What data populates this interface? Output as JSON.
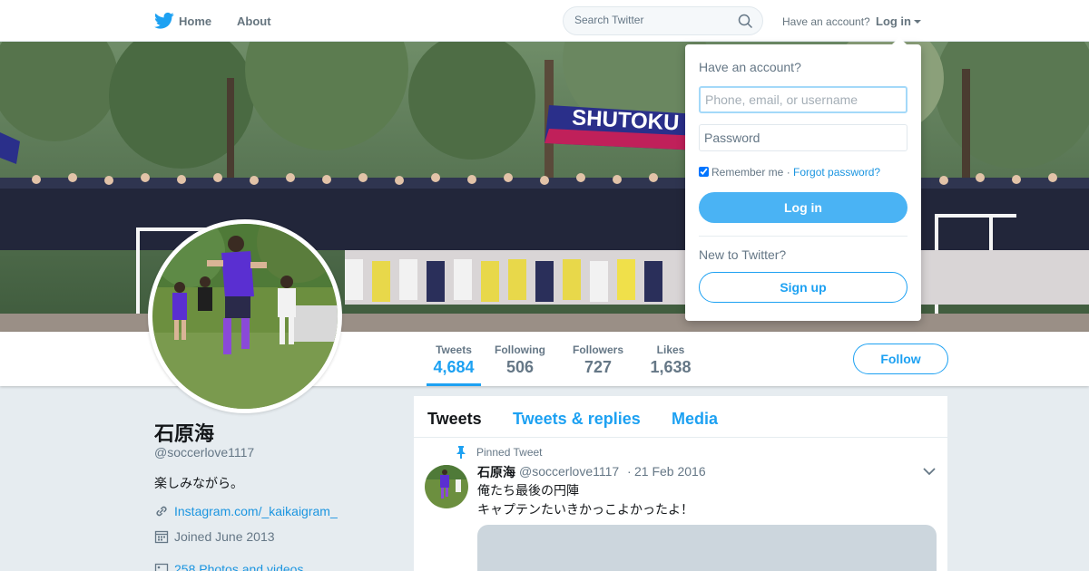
{
  "nav": {
    "home_label": "Home",
    "about_label": "About",
    "search_placeholder": "Search Twitter",
    "have_account": "Have an account?",
    "login_label": "Log in"
  },
  "profile": {
    "name": "石原海",
    "handle": "@soccerlove1117",
    "bio": "楽しみながら。",
    "website": "Instagram.com/_kaikaigram_",
    "joined": "Joined June 2013",
    "photos": "258 Photos and videos",
    "banner_text": "SHUTOKU"
  },
  "stats": [
    {
      "label": "Tweets",
      "value": "4,684"
    },
    {
      "label": "Following",
      "value": "506"
    },
    {
      "label": "Followers",
      "value": "727"
    },
    {
      "label": "Likes",
      "value": "1,638"
    }
  ],
  "follow_label": "Follow",
  "timeline": {
    "tabs": [
      "Tweets",
      "Tweets & replies",
      "Media"
    ],
    "pinned_label": "Pinned Tweet",
    "tweet": {
      "name": "石原海",
      "handle": "@soccerlove1117",
      "separator": "·",
      "date": "21 Feb 2016",
      "line1": "俺たち最後の円陣",
      "line2": "キャプテンたいきかっこよかったよ！"
    }
  },
  "login_dropdown": {
    "title": "Have an account?",
    "username_placeholder": "Phone, email, or username",
    "password_placeholder": "Password",
    "remember_label": "Remember me",
    "separator": " · ",
    "forgot_label": "Forgot password?",
    "login_button": "Log in",
    "new_to_twitter": "New to Twitter?",
    "signup_button": "Sign up"
  },
  "colors": {
    "accent": "#1da1f2",
    "background": "#e6ecf0",
    "secondary_text": "#657786",
    "login_button": "#4ab3f4"
  },
  "icons": [
    "twitter-bird-icon",
    "search-icon",
    "link-icon",
    "calendar-icon",
    "photo-icon",
    "pin-icon",
    "chevron-down-icon"
  ]
}
